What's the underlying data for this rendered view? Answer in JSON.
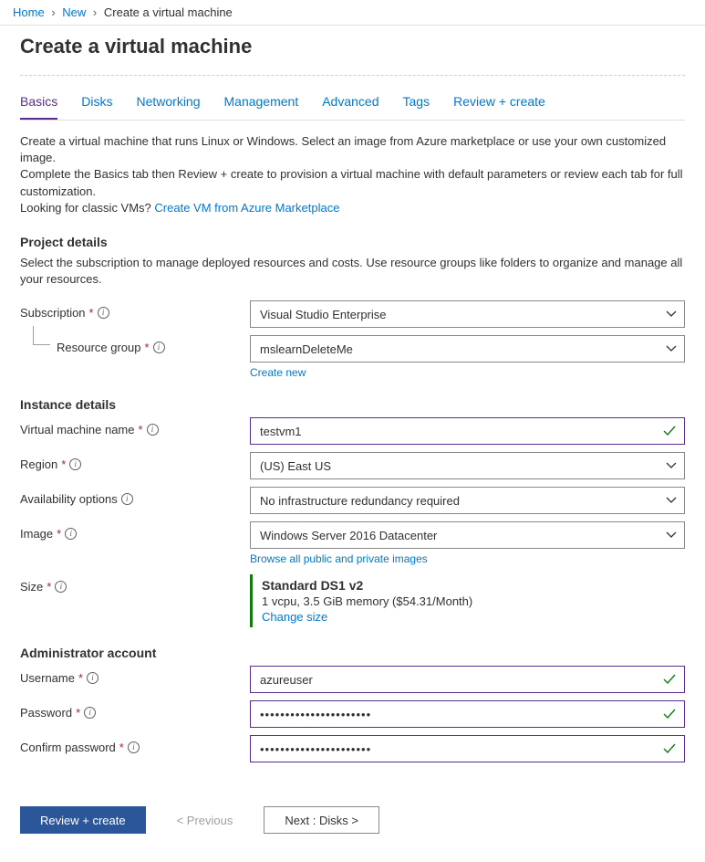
{
  "breadcrumb": {
    "home": "Home",
    "new": "New",
    "current": "Create a virtual machine"
  },
  "title": "Create a virtual machine",
  "tabs": [
    "Basics",
    "Disks",
    "Networking",
    "Management",
    "Advanced",
    "Tags",
    "Review + create"
  ],
  "intro": {
    "line1": "Create a virtual machine that runs Linux or Windows. Select an image from Azure marketplace or use your own customized image.",
    "line2": "Complete the Basics tab then Review + create to provision a virtual machine with default parameters or review each tab for full customization.",
    "classic_prefix": "Looking for classic VMs?  ",
    "classic_link": "Create VM from Azure Marketplace"
  },
  "project": {
    "heading": "Project details",
    "desc": "Select the subscription to manage deployed resources and costs. Use resource groups like folders to organize and manage all your resources.",
    "subscription_label": "Subscription",
    "subscription_value": "Visual Studio Enterprise",
    "rg_label": "Resource group",
    "rg_value": "mslearnDeleteMe",
    "rg_create": "Create new"
  },
  "instance": {
    "heading": "Instance details",
    "vmname_label": "Virtual machine name",
    "vmname_value": "testvm1",
    "region_label": "Region",
    "region_value": "(US) East US",
    "avail_label": "Availability options",
    "avail_value": "No infrastructure redundancy required",
    "image_label": "Image",
    "image_value": "Windows Server 2016 Datacenter",
    "image_browse": "Browse all public and private images",
    "size_label": "Size",
    "size_name": "Standard DS1 v2",
    "size_spec": "1 vcpu, 3.5 GiB memory ($54.31/Month)",
    "size_change": "Change size"
  },
  "admin": {
    "heading": "Administrator account",
    "user_label": "Username",
    "user_value": "azureuser",
    "pw_label": "Password",
    "pw_value": "••••••••••••••••••••••",
    "cpw_label": "Confirm password",
    "cpw_value": "••••••••••••••••••••••"
  },
  "footer": {
    "review": "Review + create",
    "prev": "<  Previous",
    "next": "Next : Disks  >"
  }
}
